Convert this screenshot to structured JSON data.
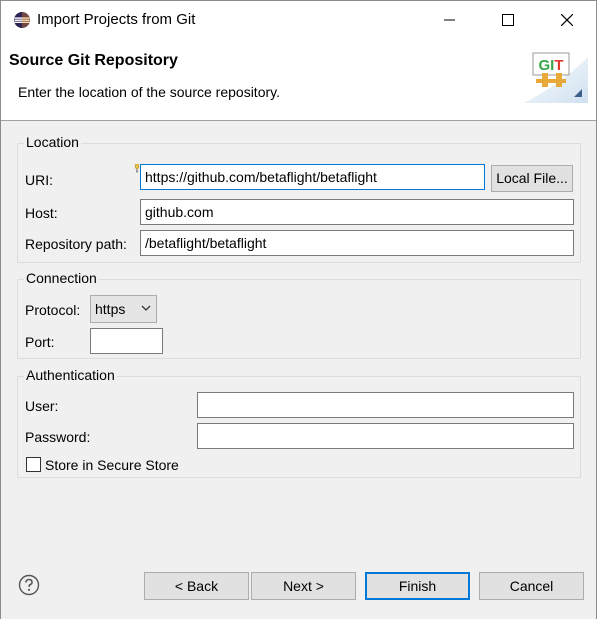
{
  "window": {
    "title": "Import Projects from Git"
  },
  "header": {
    "title": "Source Git Repository",
    "description": "Enter the location of the source repository.",
    "logo_text": "GIT"
  },
  "location": {
    "group_label": "Location",
    "uri_label": "URI:",
    "uri_value": "https://github.com/betaflight/betaflight",
    "local_file_label": "Local File...",
    "host_label": "Host:",
    "host_value": "github.com",
    "repo_path_label": "Repository path:",
    "repo_path_value": "/betaflight/betaflight"
  },
  "connection": {
    "group_label": "Connection",
    "protocol_label": "Protocol:",
    "protocol_value": "https",
    "port_label": "Port:",
    "port_value": ""
  },
  "authentication": {
    "group_label": "Authentication",
    "user_label": "User:",
    "user_value": "",
    "password_label": "Password:",
    "password_value": "",
    "store_label": "Store in Secure Store",
    "store_checked": false
  },
  "footer": {
    "back_label": "< Back",
    "next_label": "Next >",
    "finish_label": "Finish",
    "cancel_label": "Cancel"
  },
  "colors": {
    "accent": "#0078d7",
    "logo_green": "#3aa64a",
    "logo_red": "#e03a2f"
  }
}
